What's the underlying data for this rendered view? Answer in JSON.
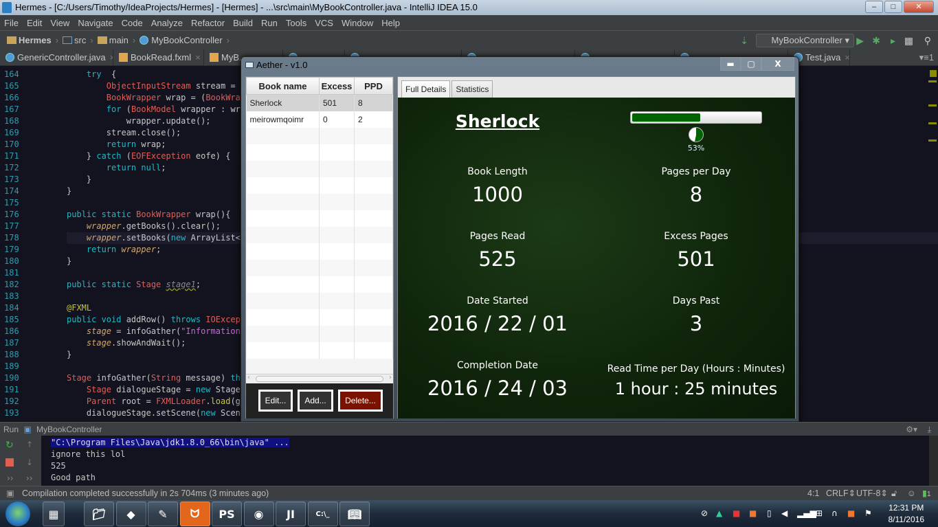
{
  "window": {
    "title": "Hermes - [C:/Users/Timothy/IdeaProjects/Hermes] - [Hermes] - ...\\src\\main\\MyBookController.java - IntelliJ IDEA 15.0"
  },
  "menu": [
    "File",
    "Edit",
    "View",
    "Navigate",
    "Code",
    "Analyze",
    "Refactor",
    "Build",
    "Run",
    "Tools",
    "VCS",
    "Window",
    "Help"
  ],
  "breadcrumb": [
    "Hermes",
    "src",
    "main",
    "MyBookController"
  ],
  "run_config": "MyBookController",
  "editor_tabs": [
    {
      "label": "GenericController.java"
    },
    {
      "label": "BookRead.fxml"
    },
    {
      "label": "MyB..."
    },
    {
      "label": ""
    },
    {
      "label": ""
    },
    {
      "label": ""
    },
    {
      "label": ""
    },
    {
      "label": ""
    },
    {
      "label": "Test.java"
    }
  ],
  "tabs_overflow": "1",
  "code": [
    {
      "n": "164",
      "ind": "    ",
      "tk": [
        [
          "kw",
          "try"
        ],
        [
          "",
          "  {"
        ]
      ]
    },
    {
      "n": "165",
      "ind": "        ",
      "tk": [
        [
          "ty",
          "ObjectInputStream"
        ],
        [
          "",
          " stream = "
        ],
        [
          "kw",
          "n"
        ]
      ]
    },
    {
      "n": "166",
      "ind": "        ",
      "tk": [
        [
          "ty",
          "BookWrapper"
        ],
        [
          "",
          " wrap = ("
        ],
        [
          "ty",
          "BookWrap"
        ]
      ]
    },
    {
      "n": "167",
      "ind": "        ",
      "tk": [
        [
          "kw",
          "for"
        ],
        [
          "",
          " ("
        ],
        [
          "ty",
          "BookModel"
        ],
        [
          "",
          " wrapper : wra"
        ]
      ]
    },
    {
      "n": "168",
      "ind": "            ",
      "tk": [
        [
          "",
          "wrapper.update();"
        ]
      ]
    },
    {
      "n": "169",
      "ind": "        ",
      "tk": [
        [
          "",
          "stream.close();"
        ]
      ]
    },
    {
      "n": "170",
      "ind": "        ",
      "tk": [
        [
          "kw",
          "return"
        ],
        [
          "",
          " wrap;"
        ]
      ]
    },
    {
      "n": "171",
      "ind": "    ",
      "tk": [
        [
          "",
          "} "
        ],
        [
          "kw",
          "catch"
        ],
        [
          "",
          " ("
        ],
        [
          "ty",
          "EOFException"
        ],
        [
          "",
          " eofe) {"
        ]
      ]
    },
    {
      "n": "172",
      "ind": "        ",
      "tk": [
        [
          "kw",
          "return null"
        ],
        [
          "",
          ";"
        ]
      ]
    },
    {
      "n": "173",
      "ind": "    ",
      "tk": [
        [
          "",
          "}"
        ]
      ]
    },
    {
      "n": "174",
      "ind": "",
      "tk": [
        [
          "",
          "}"
        ]
      ]
    },
    {
      "n": "175",
      "ind": "",
      "tk": []
    },
    {
      "n": "176",
      "ind": "",
      "tk": [
        [
          "kw",
          "public static "
        ],
        [
          "ty",
          "BookWrapper"
        ],
        [
          "",
          " wrap(){"
        ]
      ]
    },
    {
      "n": "177",
      "ind": "    ",
      "tk": [
        [
          "it",
          "wrapper"
        ],
        [
          "",
          ".getBooks().clear();"
        ]
      ]
    },
    {
      "n": "178",
      "ind": "    ",
      "tk": [
        [
          "it",
          "wrapper"
        ],
        [
          "",
          ".setBooks("
        ],
        [
          "kw",
          "new"
        ],
        [
          "",
          " ArrayList<>"
        ]
      ]
    },
    {
      "n": "179",
      "ind": "    ",
      "tk": [
        [
          "kw",
          "return "
        ],
        [
          "it",
          "wrapper"
        ],
        [
          "",
          ";"
        ]
      ]
    },
    {
      "n": "180",
      "ind": "",
      "tk": [
        [
          "",
          "}"
        ]
      ]
    },
    {
      "n": "181",
      "ind": "",
      "tk": []
    },
    {
      "n": "182",
      "ind": "",
      "tk": [
        [
          "kw",
          "public static "
        ],
        [
          "ty",
          "Stage"
        ],
        [
          "",
          " "
        ],
        [
          "gr",
          "stage1"
        ],
        [
          "",
          ";"
        ]
      ]
    },
    {
      "n": "183",
      "ind": "",
      "tk": []
    },
    {
      "n": "184",
      "ind": "",
      "tk": [
        [
          "an",
          "@FXML"
        ]
      ]
    },
    {
      "n": "185",
      "ind": "",
      "tk": [
        [
          "kw",
          "public void "
        ],
        [
          "",
          "addRow() "
        ],
        [
          "kw",
          "throws "
        ],
        [
          "ty",
          "IOExcept"
        ]
      ]
    },
    {
      "n": "186",
      "ind": "    ",
      "tk": [
        [
          "it",
          "stage"
        ],
        [
          "",
          " = infoGather("
        ],
        [
          "st",
          "\"Information "
        ]
      ]
    },
    {
      "n": "187",
      "ind": "    ",
      "tk": [
        [
          "it",
          "stage"
        ],
        [
          "",
          ".showAndWait();"
        ]
      ]
    },
    {
      "n": "188",
      "ind": "",
      "tk": [
        [
          "",
          "}"
        ]
      ]
    },
    {
      "n": "189",
      "ind": "",
      "tk": []
    },
    {
      "n": "190",
      "ind": "",
      "tk": [
        [
          "ty",
          "Stage"
        ],
        [
          "",
          " infoGather("
        ],
        [
          "ty",
          "String"
        ],
        [
          "",
          " message) "
        ],
        [
          "kw",
          "thr"
        ]
      ]
    },
    {
      "n": "191",
      "ind": "    ",
      "tk": [
        [
          "ty",
          "Stage"
        ],
        [
          "",
          " dialogueStage = "
        ],
        [
          "kw",
          "new"
        ],
        [
          "",
          " Stage("
        ]
      ]
    },
    {
      "n": "192",
      "ind": "    ",
      "tk": [
        [
          "ty",
          "Parent"
        ],
        [
          "",
          " root = "
        ],
        [
          "ty",
          "FXMLLoader"
        ],
        [
          "",
          "."
        ],
        [
          "an",
          "load"
        ],
        [
          "",
          "(ge"
        ]
      ]
    },
    {
      "n": "193",
      "ind": "    ",
      "tk": [
        [
          "",
          "dialogueStage.setScene("
        ],
        [
          "kw",
          "new"
        ],
        [
          "",
          " Scene"
        ]
      ]
    }
  ],
  "dialog": {
    "title": "Aether - v1.0",
    "table": {
      "headers": [
        "Book name",
        "Excess",
        "PPD"
      ],
      "rows": [
        [
          "Sherlock",
          "501",
          "8"
        ],
        [
          "meirowmqoimr",
          "0",
          "2"
        ]
      ]
    },
    "buttons": {
      "edit": "Edit...",
      "add": "Add...",
      "delete": "Delete..."
    },
    "tabs": [
      "Full Details",
      "Statistics"
    ],
    "details": {
      "book_title": "Sherlock",
      "progress": 0.53,
      "progress_label": "53%",
      "fields": [
        {
          "label": "Book Length",
          "value": "1000"
        },
        {
          "label": "Pages per Day",
          "value": "8"
        },
        {
          "label": "Pages Read",
          "value": "525"
        },
        {
          "label": "Excess Pages",
          "value": "501"
        },
        {
          "label": "Date Started",
          "value": "2016 / 22 / 01"
        },
        {
          "label": "Days Past",
          "value": "3"
        },
        {
          "label": "Completion Date",
          "value": "2016 / 24 / 03"
        },
        {
          "label": "Read Time per Day (Hours : Minutes)",
          "value": "1 hour : 25 minutes"
        }
      ]
    },
    "colors": {
      "accent": "#006400",
      "delete": "#7b1200"
    }
  },
  "run": {
    "label": "Run",
    "config": "MyBookController",
    "console": [
      "\"C:\\Program Files\\Java\\jdk1.8.0_66\\bin\\java\" ...",
      "ignore this lol",
      "525",
      "Good path"
    ]
  },
  "status": {
    "message": "Compilation completed successfully in 2s 704ms (3 minutes ago)",
    "position": "4:1",
    "line_sep": "CRLF",
    "encoding": "UTF-8",
    "events": "1"
  },
  "taskbar": {
    "time": "12:31 PM",
    "date": "8/11/2016",
    "apps": [
      "film-icon",
      "explorer-icon",
      "sticky-icon",
      "notepad-icon",
      "xampp-icon",
      "phpstorm-icon",
      "firefox-icon",
      "intellij-icon",
      "cmd-icon",
      "book-icon"
    ]
  }
}
